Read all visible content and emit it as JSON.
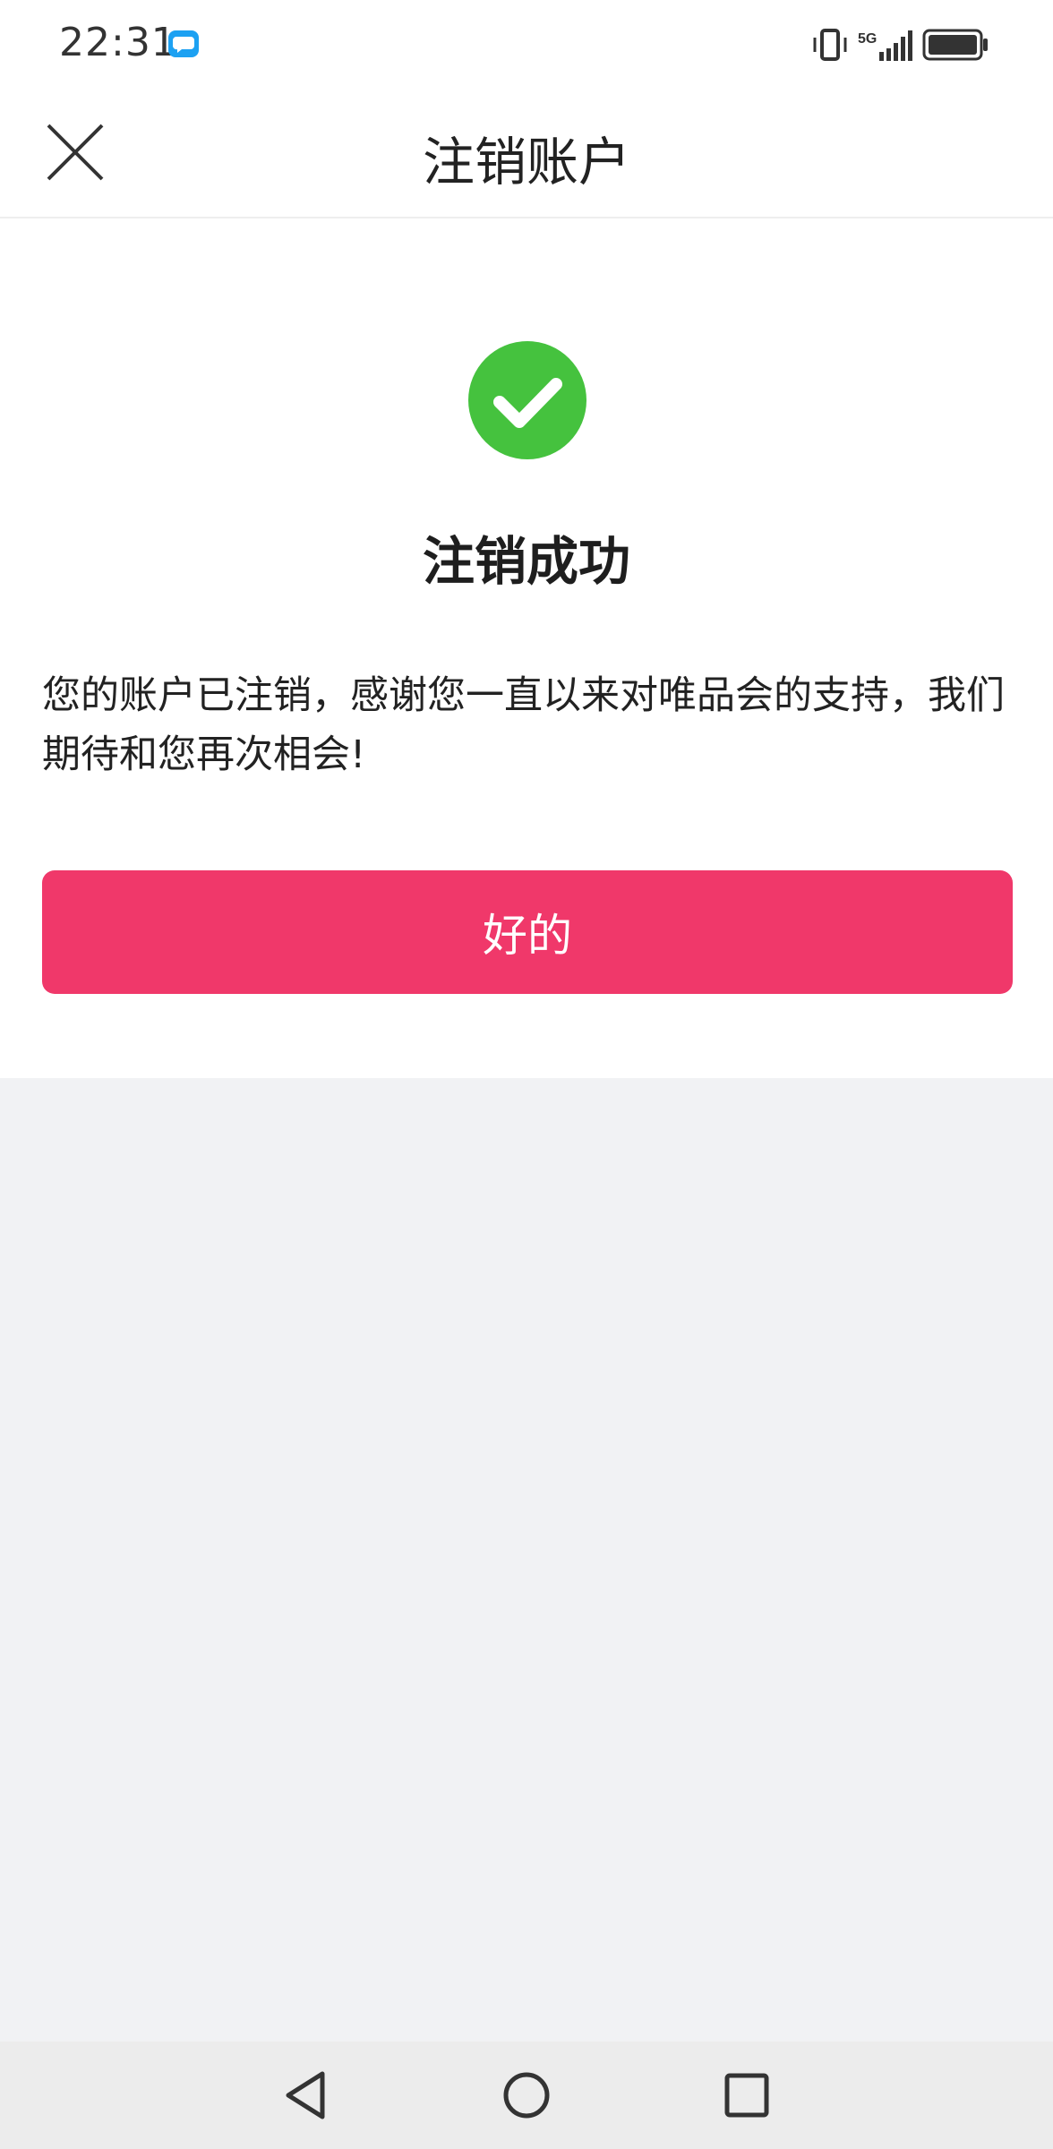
{
  "status_bar": {
    "time": "22:31",
    "network_label": "5G",
    "icons": [
      "message-app-icon",
      "vibrate-icon",
      "signal-icon",
      "battery-icon"
    ]
  },
  "header": {
    "title": "注销账户",
    "close_icon": "close-icon"
  },
  "result": {
    "icon": "check-circle-icon",
    "icon_color": "#45c23e",
    "title": "注销成功",
    "message": "您的账户已注销，感谢您一直以来对唯品会的支持，我们期待和您再次相会!"
  },
  "actions": {
    "ok_label": "好的",
    "ok_color": "#f0386a"
  },
  "system_nav": {
    "back_icon": "back-triangle-icon",
    "home_icon": "home-circle-icon",
    "recents_icon": "recents-square-icon"
  }
}
